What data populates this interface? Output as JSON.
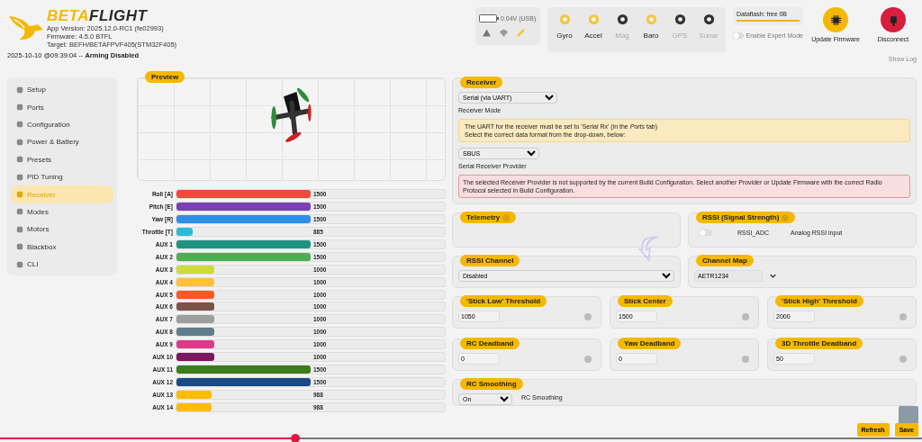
{
  "header": {
    "logo": {
      "part_1": "BETA",
      "part_2": "FLIGHT"
    },
    "app_version": "App Version: 2025.12.0-RC1 (fe02993)",
    "firmware": "Firmware: 4.5.0 BTFL",
    "target": "Target: BEFH/BETAFPVF405(STM32F405)",
    "status_line": "2025-10-10 @09:39:04 -- **Arming Disabled**"
  },
  "battery": {
    "reading": "0.04V (USB)"
  },
  "sensors": [
    {
      "label": "Gyro",
      "on": true
    },
    {
      "label": "Accel",
      "on": true
    },
    {
      "label": "Mag",
      "on": false
    },
    {
      "label": "Baro",
      "on": true
    },
    {
      "label": "GPS",
      "on": false
    },
    {
      "label": "Sonar",
      "on": false
    }
  ],
  "dataflash": {
    "label": "Dataflash: free 0B",
    "level": 1
  },
  "expert_mode": {
    "label": "Enable Expert Mode",
    "checked": false
  },
  "buttons": [
    {
      "kind": "firmware",
      "label": "Update Firmware"
    },
    {
      "kind": "disconnect",
      "label": "Disconnect"
    }
  ],
  "show_log": "Show Log",
  "sidebar": {
    "items": [
      {
        "label": "Setup",
        "selected": false
      },
      {
        "label": "Ports",
        "selected": false
      },
      {
        "label": "Configuration",
        "selected": false
      },
      {
        "label": "Power & Battery",
        "selected": false
      },
      {
        "label": "Presets",
        "selected": false
      },
      {
        "label": "PID Tuning",
        "selected": false
      },
      {
        "label": "Receiver",
        "selected": true
      },
      {
        "label": "Modes",
        "selected": false
      },
      {
        "label": "Motors",
        "selected": false
      },
      {
        "label": "Blackbox",
        "selected": false
      },
      {
        "label": "CLI",
        "selected": false
      }
    ]
  },
  "preview": {
    "title": "Preview"
  },
  "channels": [
    {
      "name": "Roll [A]",
      "color": "#e94b3c",
      "level": 0.5,
      "reading": "1500"
    },
    {
      "name": "Pitch [E]",
      "color": "#7d3fb8",
      "level": 0.5,
      "reading": "1500"
    },
    {
      "name": "Yaw [R]",
      "color": "#2f8fe6",
      "level": 0.5,
      "reading": "1500"
    },
    {
      "name": "Throttle [T]",
      "color": "#2bbcd4",
      "level": 0.06,
      "reading": "885"
    },
    {
      "name": "AUX 1",
      "color": "#1e9480",
      "level": 0.5,
      "reading": "1500"
    },
    {
      "name": "AUX 2",
      "color": "#4caf50",
      "level": 0.5,
      "reading": "1500"
    },
    {
      "name": "AUX 3",
      "color": "#cddc39",
      "level": 0.14,
      "reading": "1000"
    },
    {
      "name": "AUX 4",
      "color": "#ffc03a",
      "level": 0.14,
      "reading": "1000"
    },
    {
      "name": "AUX 5",
      "color": "#ff5722",
      "level": 0.14,
      "reading": "1000"
    },
    {
      "name": "AUX 6",
      "color": "#795548",
      "level": 0.14,
      "reading": "1000"
    },
    {
      "name": "AUX 7",
      "color": "#9e9e9e",
      "level": 0.14,
      "reading": "1000"
    },
    {
      "name": "AUX 8",
      "color": "#607d8b",
      "level": 0.14,
      "reading": "1000"
    },
    {
      "name": "AUX 9",
      "color": "#e0388a",
      "level": 0.14,
      "reading": "1000"
    },
    {
      "name": "AUX 10",
      "color": "#7b1760",
      "level": 0.14,
      "reading": "1000"
    },
    {
      "name": "AUX 11",
      "color": "#3a7d1a",
      "level": 0.5,
      "reading": "1500"
    },
    {
      "name": "AUX 12",
      "color": "#1a4a86",
      "level": 0.5,
      "reading": "1500"
    },
    {
      "name": "AUX 13",
      "color": "#ffbb00",
      "level": 0.13,
      "reading": "988"
    },
    {
      "name": "AUX 14",
      "color": "#ffbb00",
      "level": 0.13,
      "reading": "988"
    }
  ],
  "receiver": {
    "title": "Receiver",
    "mode_value": "Serial (via UART)",
    "mode_label": "Receiver Mode",
    "notes": [
      "The UART for the receiver must be set to 'Serial Rx' (in the *Ports* tab)",
      "Select the correct data format from the drop-down, below:"
    ],
    "provider_value": "SBUS",
    "provider_label": "Serial Receiver Provider",
    "error": "The selected Receiver Provider is not supported by the current Build Configuration. Select another Provider or Update Firmware with the correct Radio Protocol selected in Build Configuration."
  },
  "telemetry": {
    "title": "Telemetry"
  },
  "rssi": {
    "title": "RSSI (Signal Strength)",
    "toggle_on": false,
    "name": "RSSI_ADC",
    "description": "Analog RSSI input"
  },
  "rssi_channel": {
    "title": "RSSI Channel",
    "value": "Disabled"
  },
  "channel_map": {
    "title": "Channel Map",
    "value": "AETR1234"
  },
  "number_fields": [
    {
      "title": "'Stick Low' Threshold",
      "value": "1050"
    },
    {
      "title": "Stick Center",
      "value": "1500"
    },
    {
      "title": "'Stick High' Threshold",
      "value": "2000"
    },
    {
      "title": "RC Deadband",
      "value": "0"
    },
    {
      "title": "Yaw Deadband",
      "value": "0"
    },
    {
      "title": "3D Throttle Deadband",
      "value": "50"
    }
  ],
  "rc_smoothing": {
    "title": "RC Smoothing",
    "value": "On",
    "label": "RC Smoothing"
  },
  "footer_buttons": [
    "Refresh",
    "Save"
  ],
  "video_progress": {
    "level": 0.32
  }
}
